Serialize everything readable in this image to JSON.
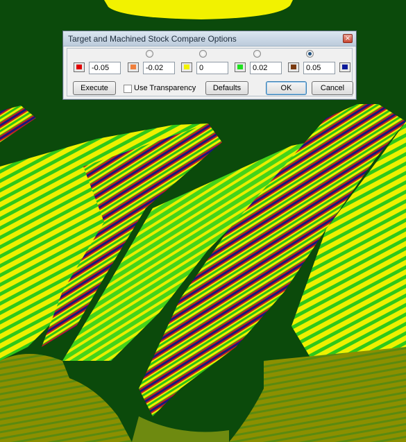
{
  "dialog": {
    "title": "Target and Machined Stock Compare Options",
    "close_glyph": "×",
    "tolerance_values": [
      "-0.05",
      "-0.02",
      "0",
      "0.02",
      "0.05"
    ],
    "swatch_colors": [
      "#e00000",
      "#f07f3c",
      "#f2f200",
      "#20e020",
      "#7a3a10",
      "#0a1a9a"
    ],
    "selected_radio_index": 4,
    "buttons": {
      "execute": "Execute",
      "defaults": "Defaults",
      "ok": "OK",
      "cancel": "Cancel"
    },
    "use_transparency_label": "Use Transparency",
    "use_transparency_checked": false
  },
  "scene_colors": {
    "background": "#0b4a0b",
    "yellow": "#f2f200",
    "green": "#30d010",
    "olive": "#8a8a00",
    "dark_band": "#1a1a7a",
    "red_band": "#c02020"
  }
}
